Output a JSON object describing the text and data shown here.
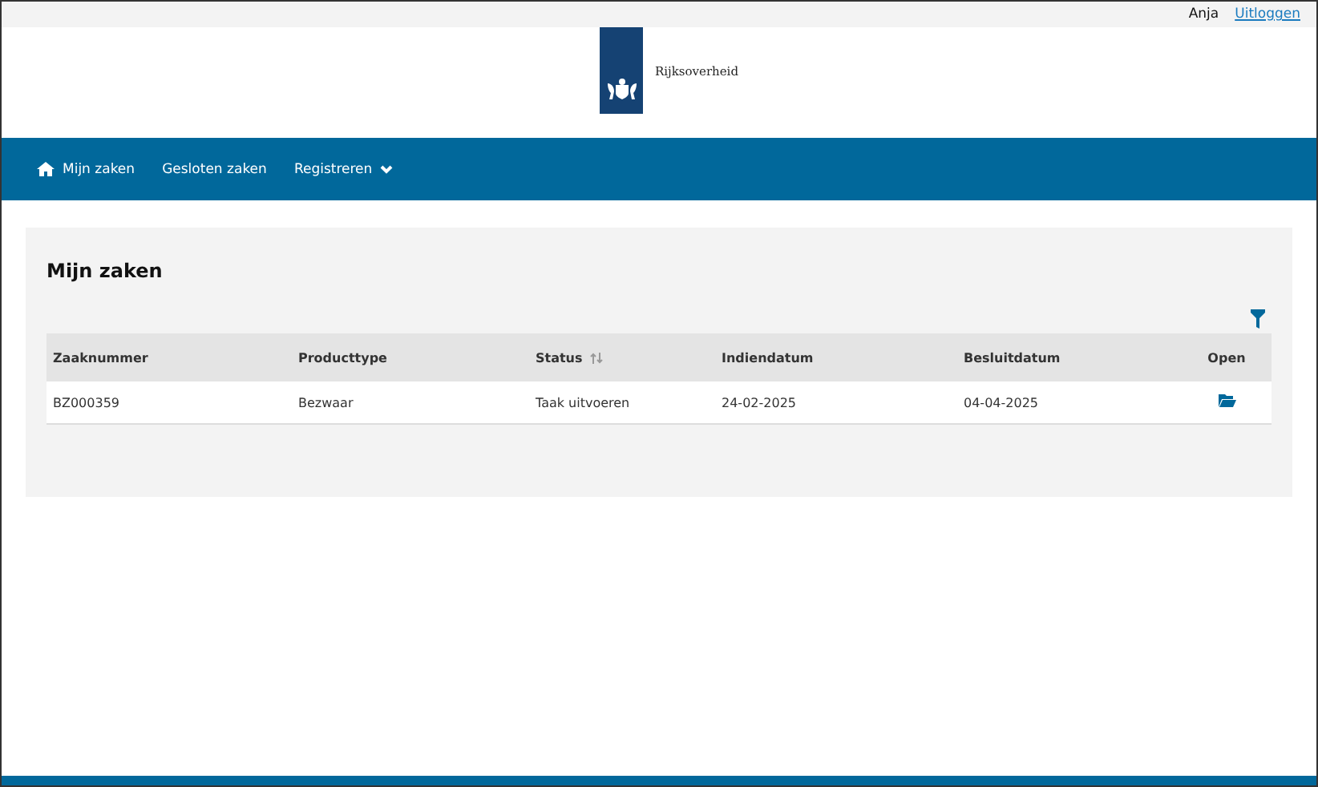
{
  "user_bar": {
    "user": "Anja",
    "logout": "Uitloggen"
  },
  "logo": {
    "text": "Rijksoverheid"
  },
  "nav": [
    {
      "label": "Mijn zaken",
      "kind": "home"
    },
    {
      "label": "Gesloten zaken",
      "kind": "plain"
    },
    {
      "label": "Registreren",
      "kind": "dropdown"
    }
  ],
  "panel": {
    "title": "Mijn zaken"
  },
  "table": {
    "columns": [
      {
        "label": "Zaaknummer",
        "sortable": false
      },
      {
        "label": "Producttype",
        "sortable": false
      },
      {
        "label": "Status",
        "sortable": true
      },
      {
        "label": "Indiendatum",
        "sortable": false
      },
      {
        "label": "Besluitdatum",
        "sortable": false
      },
      {
        "label": "Open",
        "sortable": false
      }
    ],
    "rows": [
      {
        "cells": [
          "BZ000359",
          "Bezwaar",
          "Taak uitvoeren",
          "24-02-2025",
          "04-04-2025"
        ]
      }
    ]
  }
}
